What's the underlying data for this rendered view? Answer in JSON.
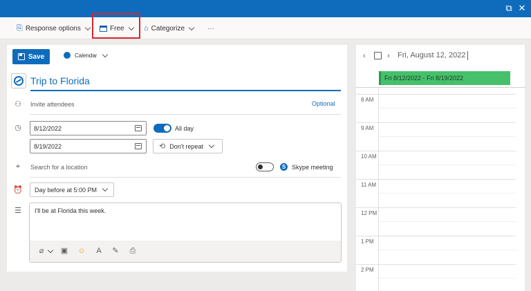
{
  "toolbar": {
    "response_options": "Response options",
    "free": "Free",
    "categorize": "Categorize",
    "more": "···"
  },
  "editor": {
    "save_label": "Save",
    "calendar_label": "Calendar",
    "title": "Trip to Florida",
    "attendees_placeholder": "Invite attendees",
    "optional_label": "Optional",
    "start_date": "8/12/2022",
    "end_date": "8/19/2022",
    "all_day_label": "All day",
    "repeat_label": "Don't repeat",
    "location_placeholder": "Search for a location",
    "skype_label": "Skype meeting",
    "reminder_label": "Day before at 5:00 PM",
    "body_text": "I'll be at Florida this week."
  },
  "side": {
    "date_heading": "Fri, August 12, 2022",
    "event_label": "Fri 8/12/2022 - Fri 8/19/2022",
    "hours": [
      "8 AM",
      "9 AM",
      "10 AM",
      "11 AM",
      "12 PM",
      "1 PM",
      "2 PM"
    ]
  },
  "colors": {
    "accent": "#0f6cbd",
    "event_green": "#46c06b",
    "highlight_red": "#d9262c"
  },
  "icons": [
    "popout-icon",
    "close-icon",
    "response-icon",
    "free-status-icon",
    "tag-icon",
    "save-icon",
    "people-icon",
    "clock-icon",
    "location-icon",
    "alarm-icon",
    "notes-icon",
    "repeat-icon",
    "skype-icon",
    "attach-icon",
    "image-icon",
    "emoji-icon",
    "format-icon",
    "draw-icon",
    "loop-icon"
  ]
}
